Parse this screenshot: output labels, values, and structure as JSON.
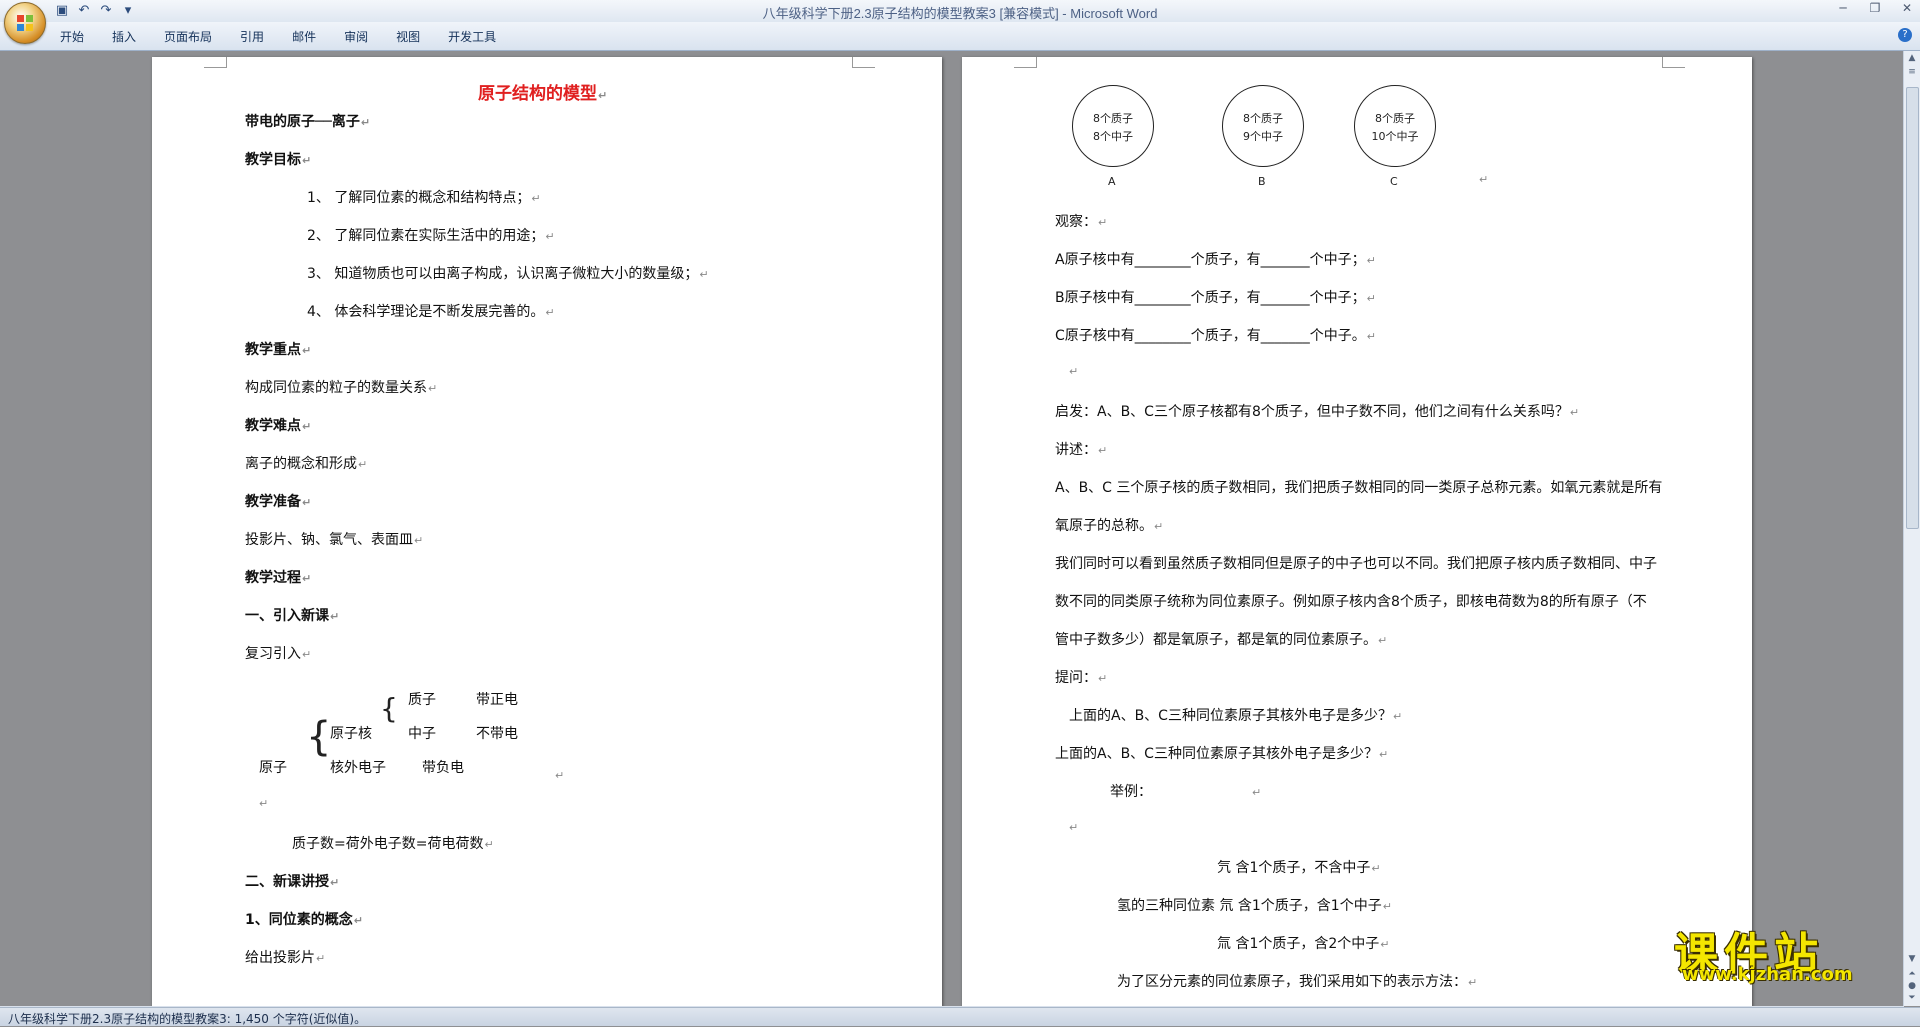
{
  "window": {
    "title": "八年级科学下册2.3原子结构的模型教案3 [兼容模式] - Microsoft Word",
    "tabs": [
      "开始",
      "插入",
      "页面布局",
      "引用",
      "邮件",
      "审阅",
      "视图",
      "开发工具"
    ]
  },
  "page1": {
    "title": "原子结构的模型",
    "lines": [
      "带电的原子──离子",
      "教学目标",
      "1、  了解同位素的概念和结构特点；",
      "2、  了解同位素在实际生活中的用途；",
      "3、  知道物质也可以由离子构成，认识离子微粒大小的数量级；",
      "4、  体会科学理论是不断发展完善的。",
      "教学重点",
      "构成同位素的粒子的数量关系",
      "教学难点",
      "离子的概念和形成",
      "教学准备",
      "投影片、钠、氯气、表面皿",
      "教学过程",
      "一、引入新课",
      "复习引入"
    ],
    "diagram": {
      "atom": "原子",
      "nucleus": "原子核",
      "electron": "核外电子",
      "proton": "质子",
      "neutron": "中子",
      "proton_charge": "带正电",
      "neutron_charge": "不带电",
      "electron_charge": "带负电"
    },
    "lines2": [
      "质子数=荷外电子数=荷电荷数",
      "二、新课讲授",
      "1、同位素的概念",
      "给出投影片"
    ]
  },
  "page2": {
    "atoms": [
      {
        "label": "A",
        "line1": "8个质子",
        "line2": "8个中子"
      },
      {
        "label": "B",
        "line1": "8个质子",
        "line2": "9个中子"
      },
      {
        "label": "C",
        "line1": "8个质子",
        "line2": "10个中子"
      }
    ],
    "lines": [
      "观察：",
      "A原子核中有________个质子，有_______个中子；",
      "B原子核中有________个质子，有_______个中子；",
      "C原子核中有________个质子，有_______个中子。",
      "",
      "启发：A、B、C三个原子核都有8个质子，但中子数不同，他们之间有什么关系吗？",
      "讲述：",
      "A、B、C 三个原子核的质子数相同，我们把质子数相同的同一类原子总称元素。如氧元素就是所有",
      "氧原子的总称。",
      "我们同时可以看到虽然质子数相同但是原子的中子也可以不同。我们把原子核内质子数相同、中子",
      "数不同的同类原子统称为同位素原子。例如原子核内含8个质子，即核电荷数为8的所有原子（不",
      "管中子数多少）都是氧原子，都是氧的同位素原子。",
      "提问：",
      "上面的A、B、C三种同位素原子其核外电子是多少？",
      "上面的A、B、C三种同位素原子其核外电子是多少？",
      "举例：",
      "",
      "氕    含1个质子，不含中子",
      "氢的三种同位素      氘    含1个质子，含1个中子",
      "氚    含1个质子，含2个中子",
      "为了区分元素的同位素原子，我们采用如下的表示方法："
    ]
  },
  "status": "八年级科学下册2.3原子结构的模型教案3: 1,450 个字符(近似值)。",
  "watermark": {
    "text": "课件站",
    "url": "www.kjzhan.com"
  }
}
